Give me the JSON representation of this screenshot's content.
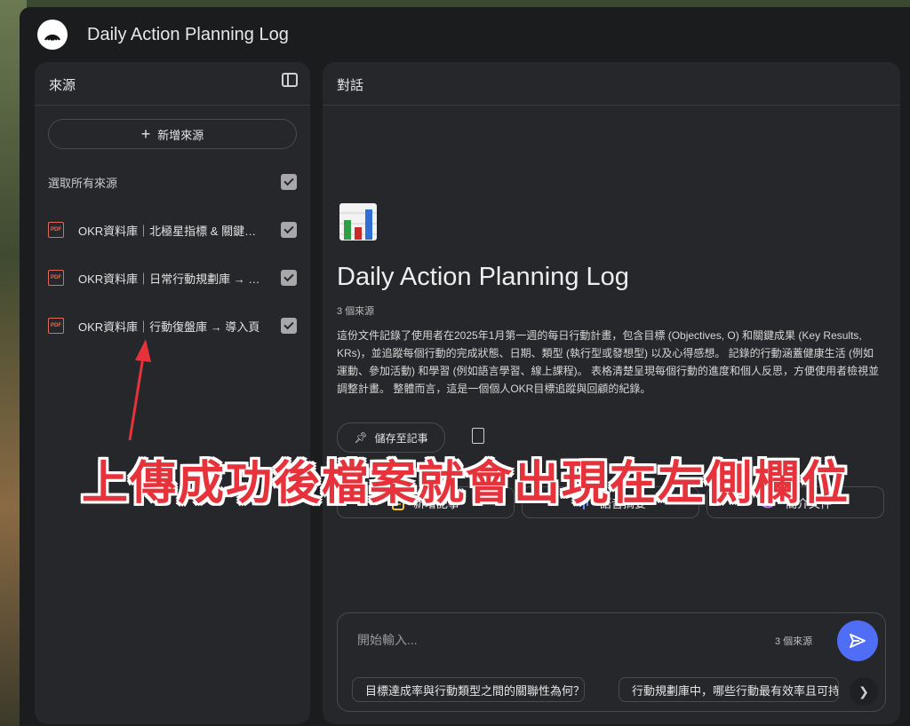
{
  "app": {
    "title": "Daily Action Planning Log"
  },
  "sources_panel": {
    "title": "來源",
    "add_source_label": "新增來源",
    "select_all_label": "選取所有來源",
    "items": [
      {
        "name": "OKR資料庫｜北極星指標 & 關鍵成果"
      },
      {
        "name": "OKR資料庫｜日常行動規劃庫 → 導入"
      },
      {
        "name": "OKR資料庫｜行動復盤庫 → 導入頁"
      }
    ],
    "pdf_icon_text": "PDF"
  },
  "chat_panel": {
    "title": "對話",
    "notebook_title": "Daily Action Planning Log",
    "source_count": "3 個來源",
    "summary": "這份文件記錄了使用者在2025年1月第一週的每日行動計畫，包含目標 (Objectives, O) 和關鍵成果 (Key Results, KRs)，並追蹤每個行動的完成狀態、日期、類型 (執行型或發想型) 以及心得感想。 記錄的行動涵蓋健康生活 (例如運動、參加活動) 和學習 (例如語言學習、線上課程)。 表格清楚呈現每個行動的進度和個人反思，方便使用者檢視並調整計畫。 整體而言，這是一個個人OKR目標追蹤與回顧的紀錄。",
    "save_note_label": "儲存至記事",
    "actions": [
      {
        "label": "新增記事",
        "icon": "note-icon"
      },
      {
        "label": "語音摘要",
        "icon": "audio-wave-icon"
      },
      {
        "label": "簡介文件",
        "icon": "graduation-cap-icon"
      }
    ],
    "composer": {
      "placeholder": "開始輸入...",
      "source_count": "3 個來源"
    },
    "suggestions": [
      "目標達成率與行動類型之間的關聯性為何？",
      "行動規劃庫中，哪些行動最有效率且可持續？"
    ]
  },
  "annotation": {
    "text": "上傳成功後檔案就會出現在左側欄位",
    "color": "#e5323b"
  },
  "colors": {
    "accent": "#4f6df5",
    "pdf_red": "#e36a5b"
  }
}
